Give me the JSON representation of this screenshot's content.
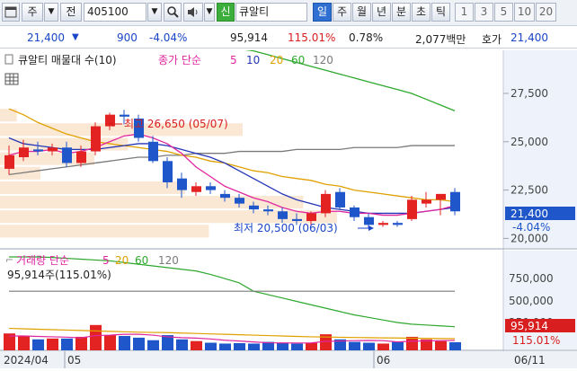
{
  "toolbar": {
    "market_type": "주",
    "period_type": "전",
    "stock_code": "405100",
    "badge": "신",
    "stock_name": "큐알티",
    "period_tabs": [
      "일",
      "주",
      "월",
      "년",
      "분",
      "초",
      "틱"
    ],
    "active_period": "일",
    "interval_tabs": [
      "1",
      "3",
      "5",
      "10",
      "20"
    ]
  },
  "quote": {
    "price": "21,400",
    "change": "900",
    "change_pct": "-4.04%",
    "volume": "95,914",
    "volume_ratio": "115.01%",
    "turnover": "0.78%",
    "amount": "2,077백만",
    "ask_label": "호가",
    "ask_price": "21,400"
  },
  "price_panel": {
    "title": "큐알티 매물대 수(10)",
    "ma_prefix": "종가 단순",
    "ma_periods": [
      "5",
      "10",
      "20",
      "60",
      "120"
    ],
    "high_annotation": "최고 26,650 (05/07)",
    "low_annotation": "최저 20,500 (06/03)",
    "axis_ticks": [
      "27,500",
      "25,000",
      "22,500",
      "20,000"
    ],
    "current_price": "21,400",
    "current_change": "-4.04%"
  },
  "volume_panel": {
    "title": "거래량 단순",
    "ma_periods": [
      "5",
      "20",
      "60",
      "120"
    ],
    "value_label": "95,914주(115.01%)",
    "axis_ticks": [
      "750,000",
      "500,000",
      "250,000"
    ],
    "current_volume": "95,914",
    "current_ratio": "115.01%"
  },
  "date_axis": {
    "labels": [
      "2024/04",
      "05",
      "06"
    ],
    "current_date": "06/11"
  },
  "colors": {
    "up": "#e32222",
    "down": "#1f56c9",
    "ma5": "#e0269f",
    "ma10": "#2436b8",
    "ma20": "#e0a000",
    "ma60": "#2ea82e",
    "ma120": "#7a7a7a",
    "price_axis_bg": "#eef3fb"
  },
  "icons": {
    "chart_toggle": "chart-window-icon",
    "search": "magnifier-icon",
    "sound": "speaker-icon",
    "grid": "grid-table-icon"
  },
  "chart_data": [
    {
      "type": "candlestick",
      "series": [
        {
          "name": "price",
          "ohlc": [
            [
              23600,
              24800,
              23300,
              24300
            ],
            [
              24200,
              25100,
              24000,
              24700
            ],
            [
              24600,
              25000,
              24300,
              24500
            ],
            [
              24500,
              24900,
              24300,
              24700
            ],
            [
              24700,
              25000,
              23700,
              23900
            ],
            [
              23900,
              24800,
              23700,
              24500
            ],
            [
              24500,
              26000,
              24300,
              25800
            ],
            [
              25800,
              26500,
              25600,
              26400
            ],
            [
              26400,
              26650,
              25900,
              26300
            ],
            [
              26200,
              26400,
              25000,
              25200
            ],
            [
              25000,
              25300,
              23900,
              24000
            ],
            [
              24000,
              24200,
              22600,
              22900
            ],
            [
              23100,
              23400,
              22100,
              22500
            ],
            [
              22400,
              22900,
              22200,
              22700
            ],
            [
              22700,
              22900,
              22300,
              22500
            ],
            [
              22300,
              22500,
              21900,
              22100
            ],
            [
              22100,
              22300,
              21600,
              21800
            ],
            [
              21700,
              21900,
              21300,
              21500
            ],
            [
              21500,
              21700,
              21200,
              21400
            ],
            [
              21400,
              21600,
              20800,
              21000
            ],
            [
              21000,
              21300,
              20700,
              20900
            ],
            [
              20900,
              21400,
              20700,
              21300
            ],
            [
              21300,
              22500,
              21100,
              22300
            ],
            [
              22400,
              22600,
              21500,
              21600
            ],
            [
              21600,
              21700,
              20900,
              21100
            ],
            [
              21100,
              21300,
              20500,
              20700
            ],
            [
              20700,
              20900,
              20600,
              20800
            ],
            [
              20800,
              20900,
              20600,
              20700
            ],
            [
              21000,
              22200,
              20900,
              22000
            ],
            [
              21800,
              22400,
              21600,
              22000
            ],
            [
              22000,
              22300,
              21200,
              22300
            ],
            [
              22400,
              22600,
              21200,
              21400
            ]
          ]
        }
      ],
      "ma5": [
        24300,
        24500,
        24500,
        24600,
        24400,
        24500,
        24700,
        25000,
        25300,
        25400,
        25200,
        24900,
        24400,
        23700,
        23200,
        22700,
        22400,
        22100,
        21900,
        21600,
        21400,
        21300,
        21400,
        21400,
        21300,
        21300,
        21200,
        21200,
        21300,
        21400,
        21500,
        21700
      ],
      "ma10": [
        25200,
        24900,
        24800,
        24700,
        24600,
        24600,
        24600,
        24700,
        24800,
        24900,
        24900,
        24800,
        24600,
        24400,
        24200,
        23900,
        23500,
        23100,
        22700,
        22300,
        22000,
        21800,
        21600,
        21500,
        21400,
        21300,
        21300,
        21300,
        21300,
        21400,
        21500,
        21600
      ],
      "ma20": [
        26700,
        26400,
        26000,
        25700,
        25400,
        25200,
        25000,
        24900,
        24800,
        24700,
        24600,
        24500,
        24300,
        24200,
        24000,
        23900,
        23700,
        23500,
        23400,
        23200,
        23100,
        23000,
        22800,
        22700,
        22500,
        22400,
        22300,
        22200,
        22100,
        22000,
        22000,
        21900
      ],
      "ma60": [
        33000,
        32500,
        32200,
        31900,
        31600,
        31400,
        31200,
        31000,
        30800,
        30700,
        30500,
        30300,
        30200,
        30100,
        30000,
        29900,
        29800,
        29700,
        29500,
        29300,
        29100,
        28900,
        28700,
        28500,
        28300,
        28100,
        27900,
        27700,
        27500,
        27200,
        26900,
        26600
      ],
      "ma120": [
        23300,
        23400,
        23500,
        23600,
        23700,
        23800,
        23900,
        24000,
        24100,
        24200,
        24200,
        24300,
        24300,
        24400,
        24400,
        24400,
        24500,
        24500,
        24500,
        24500,
        24600,
        24600,
        24600,
        24600,
        24700,
        24700,
        24700,
        24700,
        24800,
        24800,
        24800,
        24800
      ],
      "volume_profile": [
        {
          "price_from": 20000,
          "price_to": 20750,
          "volume": 0.62
        },
        {
          "price_from": 20750,
          "price_to": 21500,
          "volume": 1.0
        },
        {
          "price_from": 21500,
          "price_to": 22250,
          "volume": 0.9
        },
        {
          "price_from": 22250,
          "price_to": 23000,
          "volume": 0.55
        },
        {
          "price_from": 23000,
          "price_to": 23750,
          "volume": 0.12
        },
        {
          "price_from": 23750,
          "price_to": 24500,
          "volume": 0.28
        },
        {
          "price_from": 24500,
          "price_to": 25250,
          "volume": 0.38
        },
        {
          "price_from": 25250,
          "price_to": 26000,
          "volume": 0.72
        },
        {
          "price_from": 26000,
          "price_to": 26750,
          "volume": 0.05
        }
      ],
      "ylim": [
        19600,
        28800
      ]
    },
    {
      "type": "bar",
      "series": [
        {
          "name": "volume",
          "values": [
            200000,
            170000,
            130000,
            140000,
            140000,
            160000,
            300000,
            180000,
            170000,
            150000,
            120000,
            180000,
            130000,
            110000,
            90000,
            80000,
            85000,
            80000,
            100000,
            90000,
            80000,
            90000,
            190000,
            130000,
            100000,
            90000,
            80000,
            100000,
            160000,
            130000,
            110000,
            95914
          ]
        },
        {
          "name": "ma5",
          "values": [
            170000,
            170000,
            165000,
            160000,
            156000,
            148000,
            175000,
            180000,
            190000,
            190000,
            180000,
            160000,
            150000,
            145000,
            135000,
            120000,
            110000,
            100000,
            90000,
            88000,
            87000,
            88000,
            105000,
            110000,
            115000,
            117000,
            115000,
            100000,
            108000,
            112000,
            115000,
            117000
          ]
        },
        {
          "name": "ma20",
          "values": [
            260000,
            255000,
            250000,
            245000,
            240000,
            235000,
            230000,
            225000,
            220000,
            215000,
            212000,
            210000,
            205000,
            200000,
            195000,
            190000,
            185000,
            180000,
            175000,
            170000,
            165000,
            160000,
            158000,
            155000,
            152000,
            150000,
            148000,
            146000,
            144000,
            142000,
            140000,
            138000
          ]
        },
        {
          "name": "ma60",
          "values": [
            1130000,
            1120000,
            1110000,
            1100000,
            1090000,
            1080000,
            1070000,
            1060000,
            1040000,
            1020000,
            1000000,
            980000,
            960000,
            940000,
            900000,
            850000,
            800000,
            700000,
            660000,
            620000,
            580000,
            540000,
            500000,
            460000,
            420000,
            390000,
            360000,
            330000,
            310000,
            300000,
            290000,
            280000
          ]
        },
        {
          "name": "ma120",
          "values": [
            700000,
            700000,
            700000,
            700000,
            700000,
            700000,
            700000,
            700000,
            700000,
            700000,
            700000,
            700000,
            700000,
            700000,
            700000,
            700000,
            700000,
            700000,
            700000,
            700000,
            700000,
            700000,
            700000,
            700000,
            700000,
            700000,
            700000,
            700000,
            700000,
            700000,
            700000,
            700000
          ]
        }
      ],
      "ylim": [
        0,
        1000000
      ]
    }
  ]
}
